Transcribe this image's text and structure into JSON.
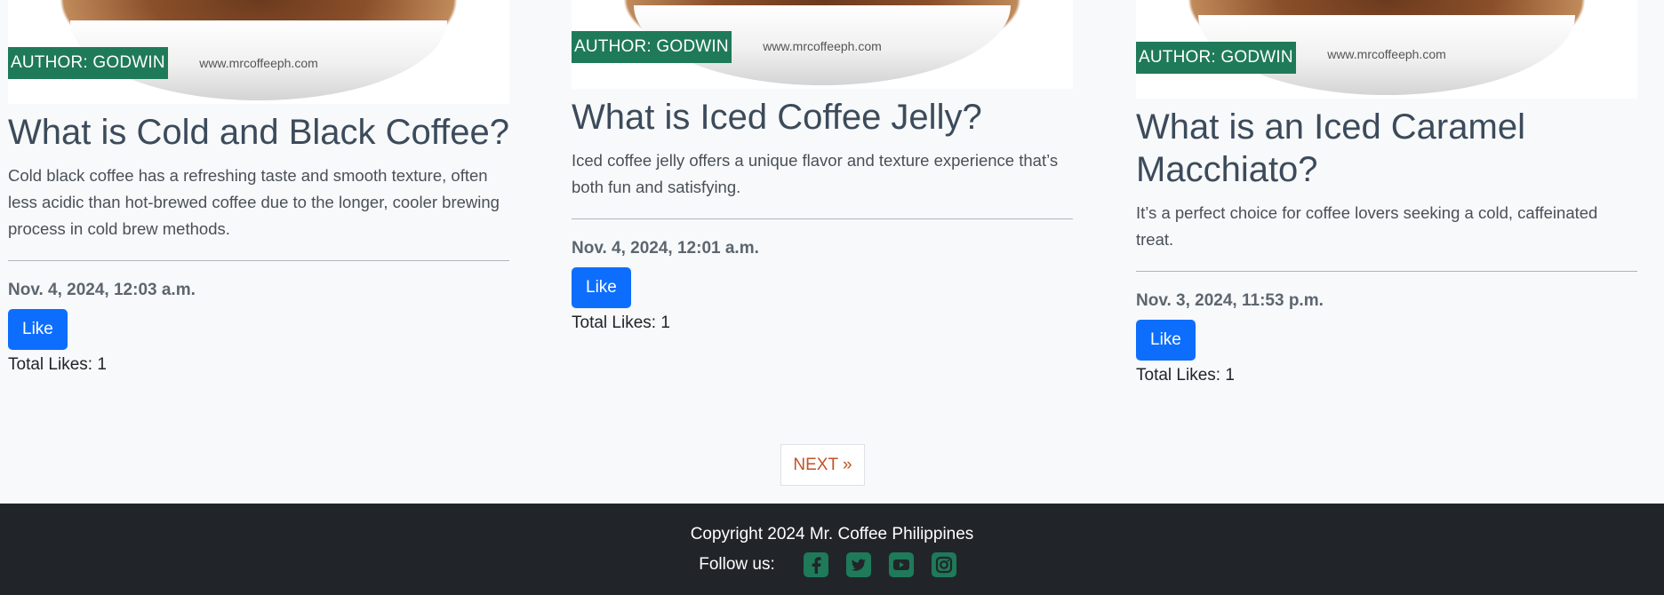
{
  "posts": [
    {
      "author": "AUTHOR: GODWIN",
      "watermark": "www.mrcoffeeph.com",
      "title": "What is Cold and Black Coffee?",
      "excerpt": "Cold black coffee has a refreshing taste and smooth texture, often less acidic than hot-brewed coffee due to the longer, cooler brewing process in cold brew methods.",
      "date": "Nov. 4, 2024, 12:03 a.m.",
      "like_label": "Like",
      "total_likes": "Total Likes: 1"
    },
    {
      "author": "AUTHOR: GODWIN",
      "watermark": "www.mrcoffeeph.com",
      "title": "What is Iced Coffee Jelly?",
      "excerpt": "Iced coffee jelly offers a unique flavor and texture experience that’s both fun and satisfying.",
      "date": "Nov. 4, 2024, 12:01 a.m.",
      "like_label": "Like",
      "total_likes": "Total Likes: 1"
    },
    {
      "author": "AUTHOR: GODWIN",
      "watermark": "www.mrcoffeeph.com",
      "title": "What is an Iced Caramel Macchiato?",
      "excerpt": "It’s a perfect choice for coffee lovers seeking a cold, caffeinated treat.",
      "date": "Nov. 3, 2024, 11:53 p.m.",
      "like_label": "Like",
      "total_likes": "Total Likes: 1"
    }
  ],
  "pagination": {
    "next_label": "NEXT »"
  },
  "footer": {
    "copyright": "Copyright 2024 Mr. Coffee Philippines",
    "follow_label": "Follow us:",
    "icons": [
      "facebook-icon",
      "twitter-icon",
      "youtube-icon",
      "instagram-icon"
    ],
    "icon_color": "#1f7a5a"
  },
  "colors": {
    "badge": "#1f7a5a",
    "like_button": "#0d6efd",
    "next_link": "#c0542a",
    "footer_bg": "#212529"
  }
}
